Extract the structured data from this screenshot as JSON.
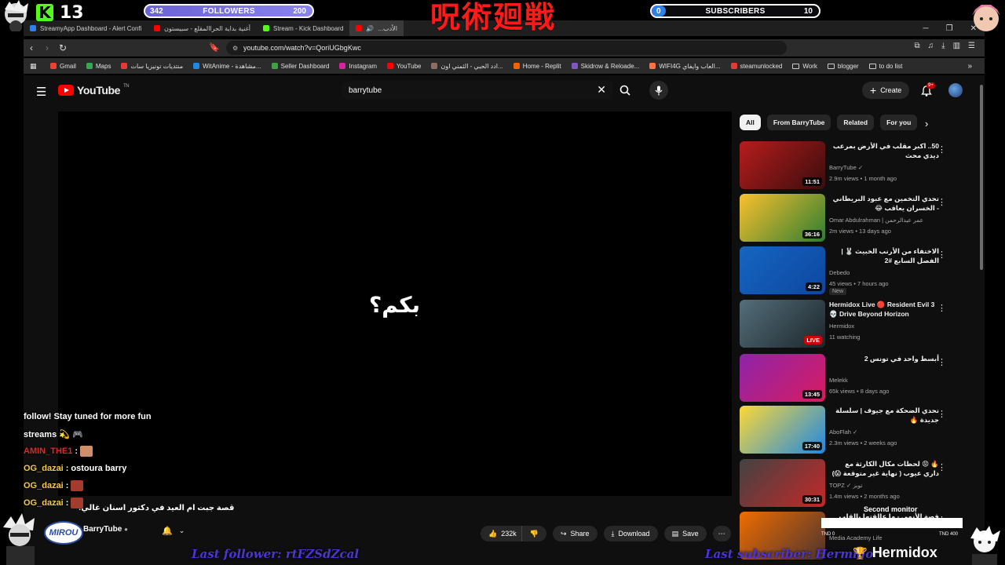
{
  "overlay": {
    "kick_count": "13",
    "followers_goal": {
      "current": "342",
      "label": "FOLLOWERS",
      "target": "200"
    },
    "subscribers_goal": {
      "current": "0",
      "label": "SUBSCRIBERS",
      "target": "10",
      "progress": 0.0
    },
    "title_art": "呪術廻戦",
    "last_follower": "Last follower: rtFZSdZcal",
    "last_subscriber": "Last subscriber: Hermido",
    "streamer_name": "Hermidox",
    "second_monitor_label": "Second monitor",
    "second_monitor_left": "TND 0",
    "second_monitor_right": "TND 400",
    "channel_logo_text": "MIROU"
  },
  "chat": {
    "messages": [
      {
        "text": "follow! Stay tuned for more fun"
      },
      {
        "text": "streams 💫 🎮"
      },
      {
        "user": "AMIN_THE1",
        "sep": ":",
        "user_color": "red",
        "emote": "light"
      },
      {
        "user": "OG_dazai",
        "sep": ":",
        "text": "ostoura barry",
        "user_color": "yellow"
      },
      {
        "user": "OG_dazai",
        "sep": ":",
        "user_color": "yellow",
        "emote": "dark"
      },
      {
        "user": "OG_dazai",
        "sep": ":",
        "user_color": "yellow",
        "emote": "dark"
      }
    ]
  },
  "browser": {
    "tabs": [
      {
        "label": "StreamyApp Dashboard - Alert Confi",
        "icon_color": "#2f80ed"
      },
      {
        "label": "أغنية بداية الحراالمقلع - سبيستون",
        "icon_color": "#ff0000"
      },
      {
        "label": "Stream - Kick Dashboard",
        "icon_color": "#53fc18"
      },
      {
        "label": "...الأدب",
        "icon_color": "#ff0000",
        "active": true
      }
    ],
    "url": "youtube.com/watch?v=QoriUGbgKwc",
    "bookmarks": [
      {
        "label": "Gmail",
        "color": "#ea4335"
      },
      {
        "label": "Maps",
        "color": "#34a853"
      },
      {
        "label": "منتديات تونيزيا سات",
        "color": "#e53935"
      },
      {
        "label": "WitAnime - مشاهدة...",
        "color": "#1e88e5"
      },
      {
        "label": "Seller Dashboard",
        "color": "#43a047"
      },
      {
        "label": "Instagram",
        "color": "#d6249f"
      },
      {
        "label": "YouTube",
        "color": "#ff0000"
      },
      {
        "label": "ادد الحبي - الثمني اون...",
        "color": "#8d6e63"
      },
      {
        "label": "Home - Replit",
        "color": "#f26207"
      },
      {
        "label": "Skidrow & Reloade...",
        "color": "#7e57c2"
      },
      {
        "label": "WIFI4G العاب وايفاي...",
        "color": "#ff7043"
      },
      {
        "label": "steamunlocked",
        "color": "#e53935"
      },
      {
        "label": "Work",
        "folder": true
      },
      {
        "label": "blogger",
        "folder": true
      },
      {
        "label": "to do list",
        "folder": true
      }
    ]
  },
  "youtube": {
    "logo_text": "YouTube",
    "logo_tm": "TN",
    "search_query": "barrytube",
    "create_label": "Create",
    "notif_count": "9+",
    "player_caption": "بكم؟",
    "video_title": "!قصة جبت ام العيد في دكتور اسنان غالي",
    "channel": "BarryTube",
    "likes": "232k",
    "share_label": "Share",
    "download_label": "Download",
    "save_label": "Save",
    "chips": [
      "All",
      "From BarryTube",
      "Related",
      "For you"
    ],
    "recommendations": [
      {
        "title": "50.. اكبر مقلب في الأرض بمرعب ديدي محث",
        "channel": "BarryTube ✓",
        "meta": "2.9m views • 1 month ago",
        "duration": "11:51",
        "thumb": [
          "#b71c1c",
          "#3b0d0d"
        ]
      },
      {
        "title": "تحدي التخمين مع عبود البريطاني - الخسران يعاقب 😂",
        "channel": "Omar Abdulrahman | عمر عبدالرحمن",
        "meta": "2m views • 13 days ago",
        "duration": "36:16",
        "thumb": [
          "#fbc02d",
          "#2e7d32"
        ]
      },
      {
        "title": "الاختفاء من الأرنب الخبيث 🐰 | الفصل السابع #2",
        "channel": "Debedo",
        "meta": "45 views • 7 hours ago",
        "duration": "4:22",
        "badge": "New",
        "thumb": [
          "#1565c0",
          "#0d47a1"
        ]
      },
      {
        "title": "Hermidox Live 🔴 Resident Evil 3 💀 Drive Beyond Horizon",
        "channel": "Hermidox",
        "meta": "11 watching",
        "duration": "LIVE",
        "live": true,
        "thumb": [
          "#546e7a",
          "#1c262b"
        ]
      },
      {
        "title": "أبسط واحد في تونس 2",
        "channel": "Melekk",
        "meta": "65k views • 8 days ago",
        "duration": "13:45",
        "thumb": [
          "#8e24aa",
          "#d81b60"
        ]
      },
      {
        "title": "تحدي الضحكة مع جيوف | سلسلة جديدة 🔥",
        "channel": "AboFlah ✓",
        "meta": "2.3m views • 2 weeks ago",
        "duration": "17:40",
        "thumb": [
          "#fdd835",
          "#1e88e5"
        ]
      },
      {
        "title": "🔥 😡 لحظات مكال الكارثة مع داري عيوب ( نهاية غير متوقعة 😱)",
        "channel": "TOPZ ✓ توبز",
        "meta": "1.4m views • 2 months ago",
        "duration": "30:31",
        "thumb": [
          "#424242",
          "#c62828"
        ]
      },
      {
        "title": "قصة الأنمي - ما عالقتها بالقلب",
        "channel": "Media Academy Life",
        "meta": "",
        "duration": "",
        "thumb": [
          "#ef6c00",
          "#4e342e"
        ]
      }
    ]
  }
}
